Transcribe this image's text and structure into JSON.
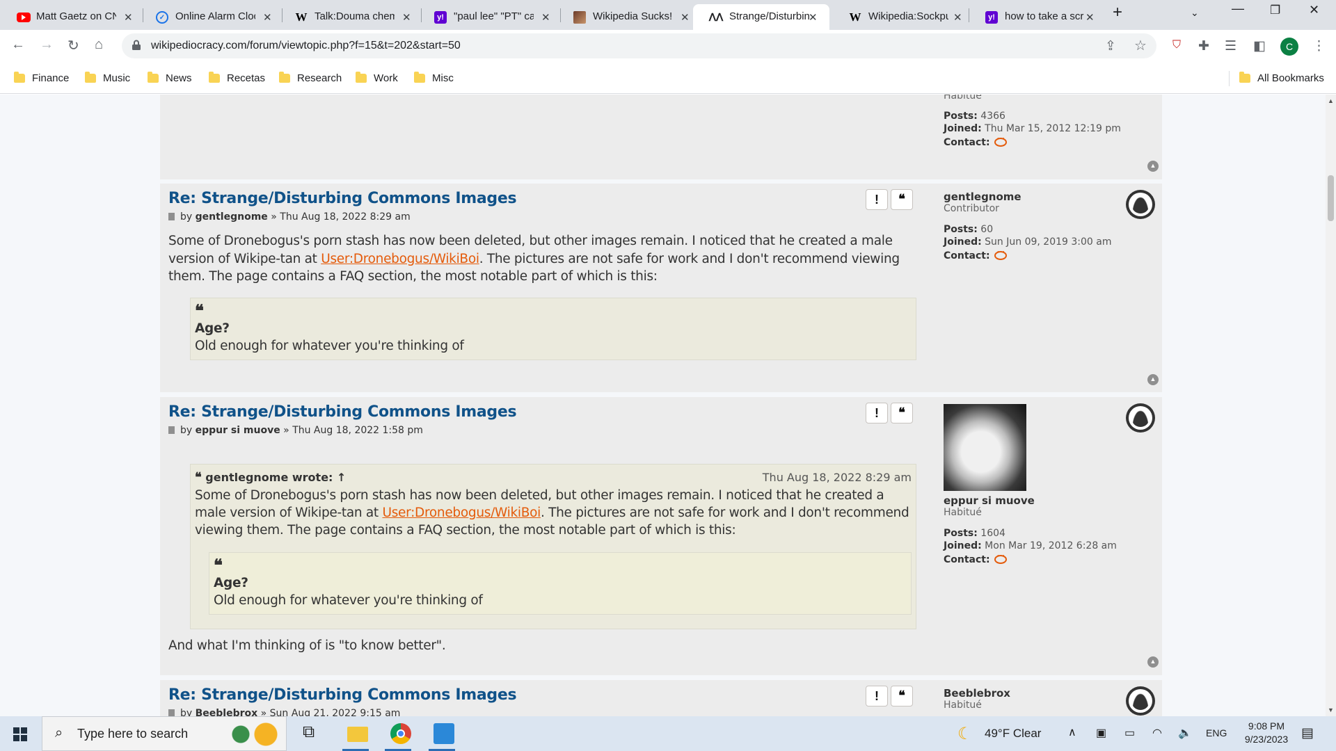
{
  "tabs": [
    {
      "title": "Matt Gaetz on CN",
      "icon": "youtube-icon"
    },
    {
      "title": "Online Alarm Cloc",
      "icon": "clock-icon"
    },
    {
      "title": "Talk:Douma chem",
      "icon": "wikipedia-icon"
    },
    {
      "title": "\"paul lee\" \"PT\" ca",
      "icon": "yahoo-icon"
    },
    {
      "title": "Wikipedia Sucks!",
      "icon": "image-icon"
    },
    {
      "title": "Strange/Disturbin",
      "icon": "wikipediocracy-icon"
    },
    {
      "title": "Wikipedia:Sockpu",
      "icon": "wikipedia-icon"
    },
    {
      "title": "how to take a scr",
      "icon": "yahoo-icon"
    }
  ],
  "address_bar": {
    "url": "wikipediocracy.com/forum/viewtopic.php?f=15&t=202&start=50"
  },
  "profile_initial": "C",
  "bookmarks": [
    "Finance",
    "Music",
    "News",
    "Recetas",
    "Research",
    "Work",
    "Misc"
  ],
  "all_bookmarks": "All Bookmarks",
  "prev_profile": {
    "rank": "Habitué",
    "posts_label": "Posts:",
    "posts": "4366",
    "joined_label": "Joined:",
    "joined": "Thu Mar 15, 2012 12:19 pm",
    "contact_label": "Contact:"
  },
  "posts": [
    {
      "title": "Re: Strange/Disturbing Commons Images",
      "by": "by",
      "author": "gentlegnome",
      "date": "» Thu Aug 18, 2022 8:29 am",
      "body_part1": "Some of Dronebogus's porn stash has now been deleted, but other images remain. I noticed that he created a male version of Wikipe-tan at ",
      "link": "User:Dronebogus/WikiBoi",
      "body_part2": ". The pictures are not safe for work and I don't recommend viewing them. The page contains a FAQ section, the most notable part of which is this:",
      "quote_q": "Age?",
      "quote_a": "Old enough for whatever you're thinking of",
      "profile": {
        "username": "gentlegnome",
        "rank": "Contributor",
        "posts_label": "Posts:",
        "posts": "60",
        "joined_label": "Joined:",
        "joined": "Sun Jun 09, 2019 3:00 am",
        "contact_label": "Contact:"
      }
    },
    {
      "title": "Re: Strange/Disturbing Commons Images",
      "by": "by",
      "author": "eppur si muove",
      "date": "» Thu Aug 18, 2022 1:58 pm",
      "quote_header": "gentlegnome wrote: ↑",
      "quote_date": "Thu Aug 18, 2022 8:29 am",
      "quote_part1": "Some of Dronebogus's porn stash has now been deleted, but other images remain. I noticed that he created a male version of Wikipe-tan at ",
      "quote_link": "User:Dronebogus/WikiBoi",
      "quote_part2": ". The pictures are not safe for work and I don't recommend viewing them. The page contains a FAQ section, the most notable part of which is this:",
      "inner_q": "Age?",
      "inner_a": "Old enough for whatever you're thinking of",
      "reply": "And what I'm thinking of is \"to know better\".",
      "profile": {
        "username": "eppur si muove",
        "rank": "Habitué",
        "posts_label": "Posts:",
        "posts": "1604",
        "joined_label": "Joined:",
        "joined": "Mon Mar 19, 2012 6:28 am",
        "contact_label": "Contact:"
      }
    },
    {
      "title": "Re: Strange/Disturbing Commons Images",
      "by": "by",
      "author": "Beeblebrox",
      "date": "» Sun Aug 21, 2022 9:15 am",
      "profile": {
        "username": "Beeblebrox",
        "rank": "Habitué"
      }
    }
  ],
  "taskbar": {
    "search_placeholder": "Type here to search",
    "weather": "49°F  Clear",
    "lang": "ENG",
    "time": "9:08 PM",
    "date": "9/23/2023"
  }
}
